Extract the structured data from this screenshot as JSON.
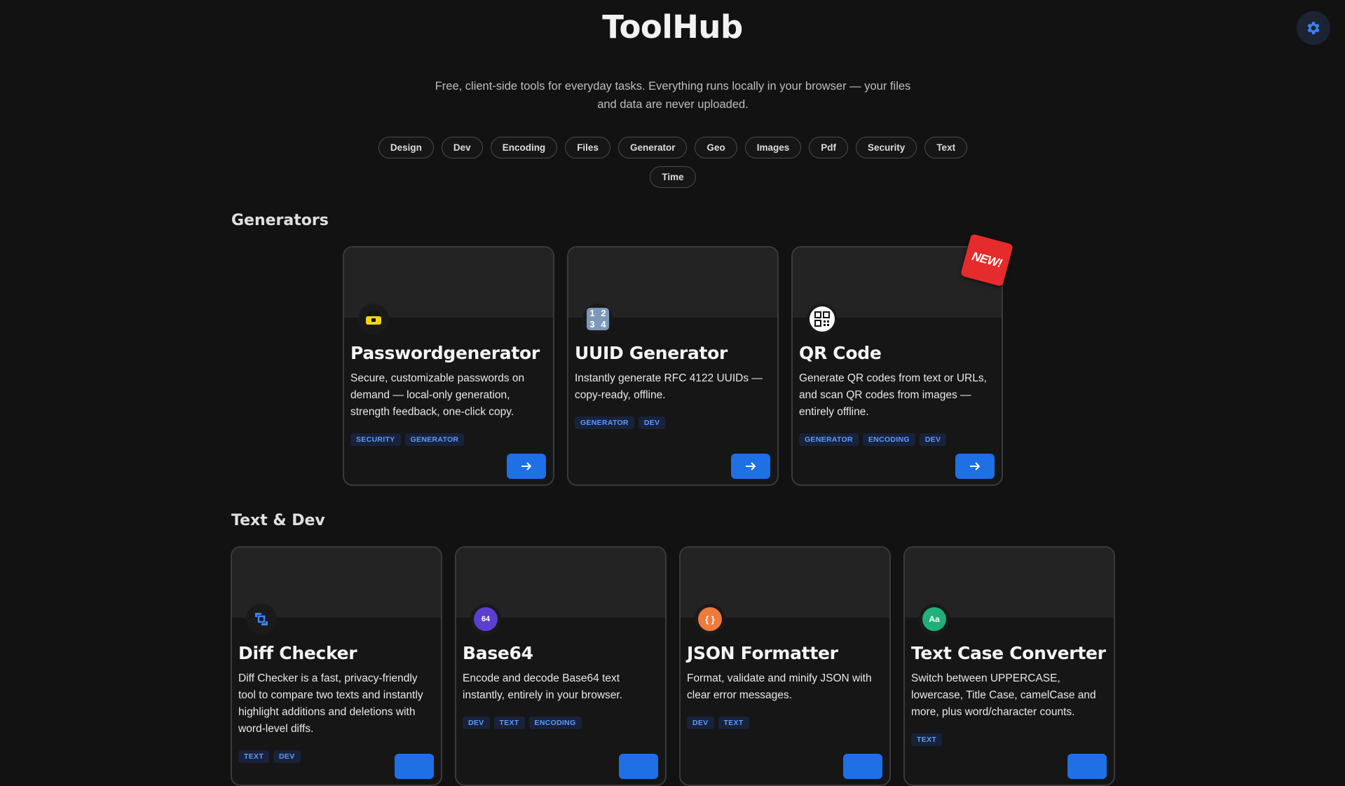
{
  "header": {
    "title": "ToolHub",
    "subtitle": "Free, client-side tools for everyday tasks. Everything runs locally in your browser — your files and data are never uploaded."
  },
  "filters": [
    "Design",
    "Dev",
    "Encoding",
    "Files",
    "Generator",
    "Geo",
    "Images",
    "Pdf",
    "Security",
    "Text",
    "Time"
  ],
  "sections": {
    "generators": {
      "title": "Generators",
      "cards": [
        {
          "title": "Passwordgenerator",
          "description": "Secure, customizable passwords on demand — local-only generation, strength feedback, one-click copy.",
          "tags": [
            "SECURITY",
            "GENERATOR"
          ],
          "icon": "lock-icon"
        },
        {
          "title": "UUID Generator",
          "description": "Instantly generate RFC 4122 UUIDs — copy-ready, offline.",
          "tags": [
            "GENERATOR",
            "DEV"
          ],
          "icon": "numbers-icon"
        },
        {
          "title": "QR Code",
          "description": "Generate QR codes from text or URLs, and scan QR codes from images — entirely offline.",
          "tags": [
            "GENERATOR",
            "ENCODING",
            "DEV"
          ],
          "icon": "qr-code-icon",
          "badge": "NEW!"
        }
      ]
    },
    "text_dev": {
      "title": "Text & Dev",
      "cards": [
        {
          "title": "Diff Checker",
          "description": "Diff Checker is a fast, privacy-friendly tool to compare two texts and instantly highlight additions and deletions with word-level diffs.",
          "tags": [
            "TEXT",
            "DEV"
          ],
          "icon": "diff-icon"
        },
        {
          "title": "Base64",
          "description": "Encode and decode Base64 text instantly, entirely in your browser.",
          "tags": [
            "DEV",
            "TEXT",
            "ENCODING"
          ],
          "icon": "base64-icon",
          "icon_text": "64"
        },
        {
          "title": "JSON Formatter",
          "description": "Format, validate and minify JSON with clear error messages.",
          "tags": [
            "DEV",
            "TEXT"
          ],
          "icon": "braces-icon",
          "icon_text": "{ }"
        },
        {
          "title": "Text Case Converter",
          "description": "Switch between UPPERCASE, lowercase, Title Case, camelCase and more, plus word/character counts.",
          "tags": [
            "TEXT"
          ],
          "icon": "text-case-icon",
          "icon_text": "Aa"
        }
      ]
    }
  },
  "colors": {
    "background": "#121212",
    "accent": "#1f6fe5",
    "tag_text": "#5b9dff",
    "badge": "#e52b2b"
  }
}
